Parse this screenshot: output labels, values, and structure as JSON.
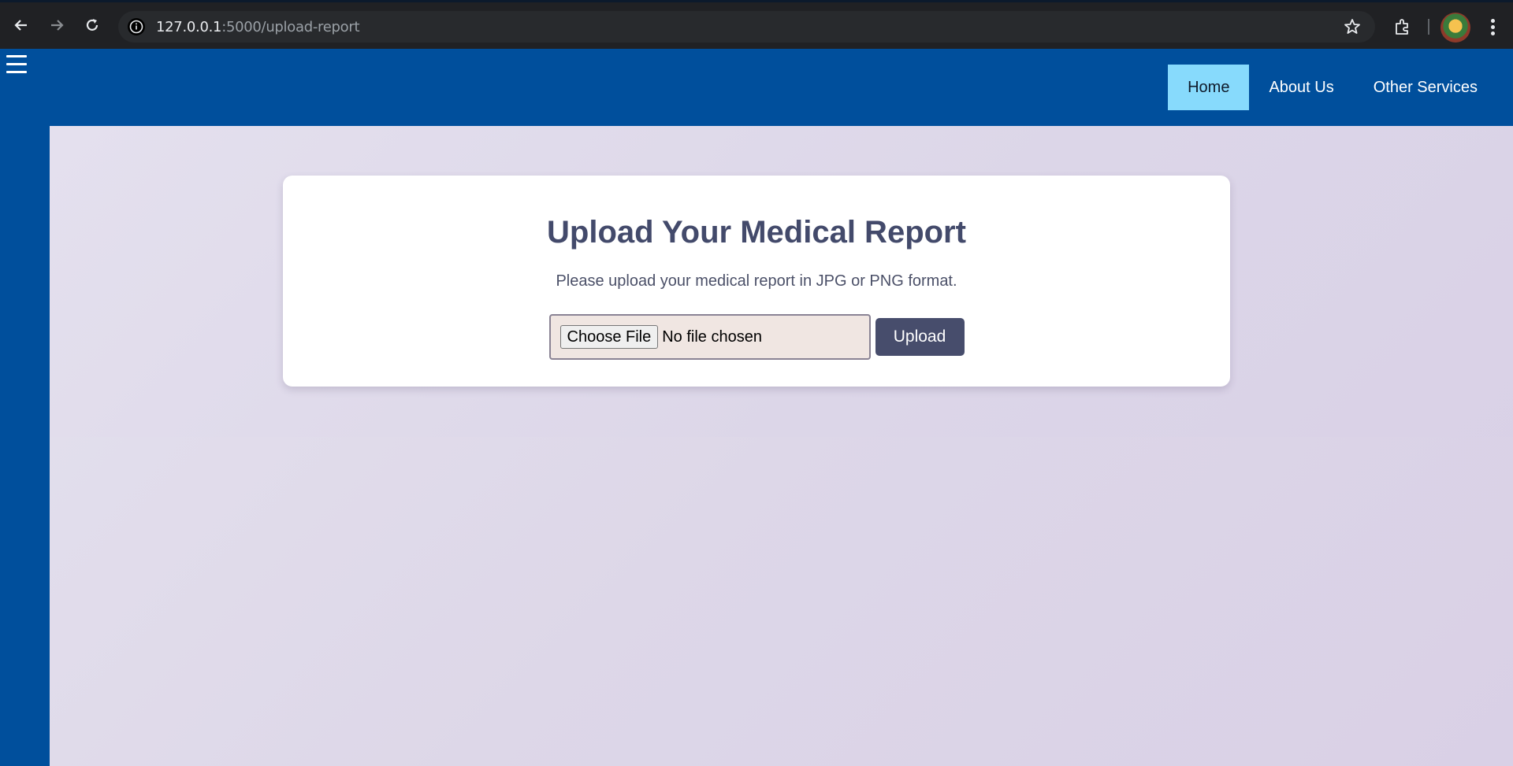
{
  "browser": {
    "url_host": "127.0.0.1",
    "url_rest": ":5000/upload-report",
    "icons": [
      "back-arrow-icon",
      "forward-arrow-icon",
      "reload-icon",
      "site-info-icon",
      "bookmark-star-icon",
      "extensions-icon",
      "profile-avatar",
      "more-vert-icon"
    ]
  },
  "header": {
    "nav": [
      {
        "label": "Home",
        "active": true
      },
      {
        "label": "About Us",
        "active": false
      },
      {
        "label": "Other Services",
        "active": false
      }
    ],
    "colors": {
      "bar": "#004f9c",
      "active": "#87dafc"
    }
  },
  "upload_card": {
    "title": "Upload Your Medical Report",
    "subtitle": "Please upload your medical report in JPG or PNG format.",
    "choose_label": "Choose File",
    "file_status": "No file chosen",
    "upload_label": "Upload"
  }
}
